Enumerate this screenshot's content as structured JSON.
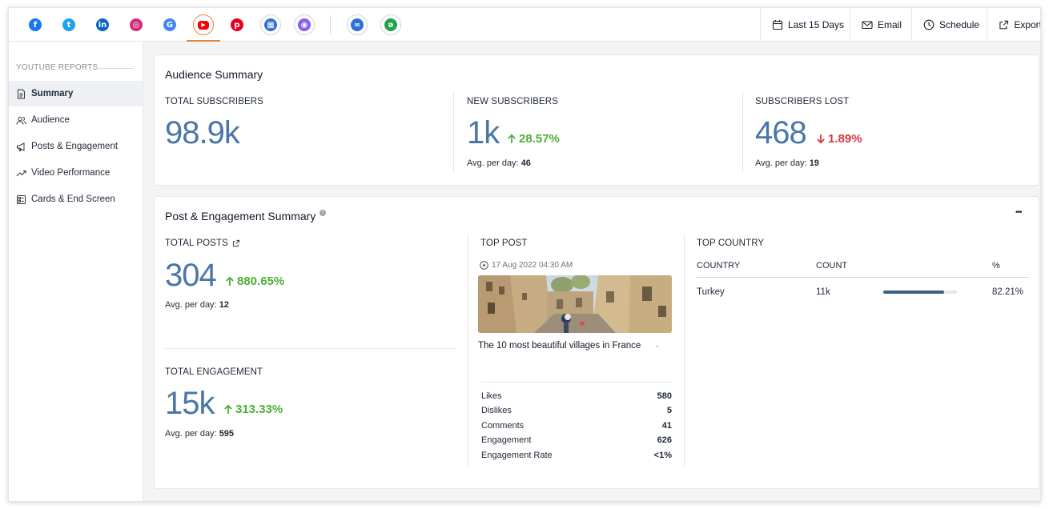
{
  "topbar": {
    "networks": [
      {
        "name": "facebook-icon",
        "glyph": "f",
        "color": "#1877f2",
        "active": false
      },
      {
        "name": "twitter-icon",
        "glyph": "t",
        "color": "#1da1f2",
        "active": false
      },
      {
        "name": "linkedin-page-icon",
        "glyph": "in",
        "color": "#0a66c2",
        "active": false
      },
      {
        "name": "instagram-icon",
        "glyph": "◎",
        "color": "#d62976",
        "active": false
      },
      {
        "name": "google-business-icon",
        "glyph": "G",
        "color": "#4285f4",
        "active": false
      },
      {
        "name": "youtube-icon",
        "glyph": "▶",
        "color": "#ff0000",
        "active": true
      },
      {
        "name": "pinterest-icon",
        "glyph": "p",
        "color": "#e60023",
        "active": false
      },
      {
        "name": "tiles-icon",
        "glyph": "▦",
        "color": "#2f6fd6",
        "active": false
      },
      {
        "name": "circle-app-icon",
        "glyph": "◉",
        "color": "#8b5cf6",
        "active": false
      },
      {
        "name": "linked-channels-icon",
        "glyph": "∞",
        "color": "#2f6fd6",
        "active": false
      },
      {
        "name": "custom-app-icon",
        "glyph": "ǝ",
        "color": "#22a34a",
        "active": false
      }
    ],
    "date_range_label": "Last 15 Days",
    "email_label": "Email",
    "schedule_label": "Schedule",
    "export_label": "Export"
  },
  "sidebar": {
    "header": "YOUTUBE REPORTS",
    "items": [
      {
        "label": "Summary",
        "icon": "document-icon",
        "active": true
      },
      {
        "label": "Audience",
        "icon": "users-icon",
        "active": false
      },
      {
        "label": "Posts & Engagement",
        "icon": "megaphone-icon",
        "active": false
      },
      {
        "label": "Video Performance",
        "icon": "trend-icon",
        "active": false
      },
      {
        "label": "Cards & End Screen",
        "icon": "cards-icon",
        "active": false
      }
    ]
  },
  "audience": {
    "title": "Audience Summary",
    "total_subscribers": {
      "label": "TOTAL SUBSCRIBERS",
      "value": "98.9k"
    },
    "new_subscribers": {
      "label": "NEW SUBSCRIBERS",
      "value": "1k",
      "delta": "28.57%",
      "avg_label": "Avg. per day:",
      "avg_value": "46"
    },
    "subscribers_lost": {
      "label": "SUBSCRIBERS LOST",
      "value": "468",
      "delta": "1.89%",
      "avg_label": "Avg. per day:",
      "avg_value": "19"
    }
  },
  "engagement": {
    "title": "Post & Engagement Summary",
    "more_label": "•••",
    "total_posts": {
      "label": "TOTAL POSTS",
      "value": "304",
      "delta": "880.65%",
      "avg_label": "Avg. per day:",
      "avg_value": "12"
    },
    "total_engagement": {
      "label": "TOTAL ENGAGEMENT",
      "value": "15k",
      "delta": "313.33%",
      "avg_label": "Avg. per day:",
      "avg_value": "595"
    },
    "top_post": {
      "label": "TOP POST",
      "date": "17 Aug 2022 04:30 AM",
      "title": "The 10 most beautiful villages in France",
      "stats": [
        {
          "label": "Likes",
          "value": "580"
        },
        {
          "label": "Dislikes",
          "value": "5"
        },
        {
          "label": "Comments",
          "value": "41"
        },
        {
          "label": "Engagement",
          "value": "626"
        },
        {
          "label": "Engagement Rate",
          "value": "<1%"
        }
      ]
    },
    "top_country": {
      "label": "TOP COUNTRY",
      "headers": {
        "country": "COUNTRY",
        "count": "COUNT",
        "percent": "%"
      },
      "rows": [
        {
          "country": "Turkey",
          "count": "11k",
          "percent": "82.21%",
          "share": 0.8221
        }
      ]
    }
  }
}
